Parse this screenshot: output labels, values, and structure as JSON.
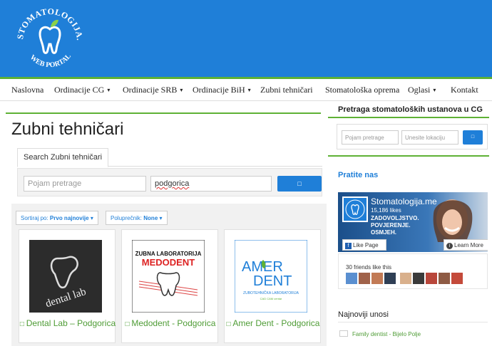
{
  "header": {
    "logo_ring_text": "STOMATOLOGIJA.ME",
    "logo_bottom_text": "WEB PORTAL"
  },
  "nav": {
    "items": [
      {
        "label": "Naslovna",
        "dropdown": false
      },
      {
        "label": "Ordinacije CG",
        "dropdown": true
      },
      {
        "label": "Ordinacije SRB",
        "dropdown": true
      },
      {
        "label": "Ordinacije BiH",
        "dropdown": true
      },
      {
        "label": "Zubni tehničari",
        "dropdown": false
      },
      {
        "label": "Stomatološka oprema",
        "dropdown": false
      },
      {
        "label": "Oglasi",
        "dropdown": true
      },
      {
        "label": "Kontakt",
        "dropdown": false
      }
    ],
    "caret": "▾"
  },
  "main": {
    "page_title": "Zubni tehničari",
    "tab_label": "Search Zubni tehničari",
    "search_placeholder": "Pojam pretrage",
    "location_value": "podgorica",
    "search_button": "",
    "sort_label": "Sortiraj po:",
    "sort_value": "Prvo najnovije",
    "radius_label": "Poluprečnik:",
    "radius_value": "None",
    "cards": [
      {
        "title": "Dental Lab – Podgorica",
        "thumb_text": "dental lab"
      },
      {
        "title": "Medodent - Podgorica",
        "thumb_line1": "ZUBNA LABORATORIJA",
        "thumb_line2": "MEDODENT"
      },
      {
        "title": "Amer Dent - Podgorica",
        "thumb_line1": "AMER",
        "thumb_line2": "DENT",
        "thumb_line3": "ZUBOTEHNIČKA LABORATORIJA",
        "thumb_line4": "CAD CAM centar"
      }
    ]
  },
  "sidebar": {
    "search_heading": "Pretraga stomatoloških ustanova u CG",
    "search_placeholder": "Pojam pretrage",
    "location_placeholder": "Unesite lokaciju",
    "follow_heading": "Pratite nas",
    "fb_page_name": "Stomatologija.me",
    "fb_likes": "15,186 likes",
    "fb_tagline1": "ZADOVOLJSTVO.",
    "fb_tagline2": "POVJERENJE.",
    "fb_tagline3": "OSMJEH.",
    "like_page": "Like Page",
    "learn_more": "Learn More",
    "friends_text": "30 friends like this",
    "latest_heading": "Najnoviji unosi",
    "latest_entries": [
      "Family dentist - Bijelo Polje"
    ]
  },
  "colors": {
    "brand_blue": "#1f7fd8",
    "accent_green": "#5eb135",
    "link_green": "#4f9c36"
  }
}
